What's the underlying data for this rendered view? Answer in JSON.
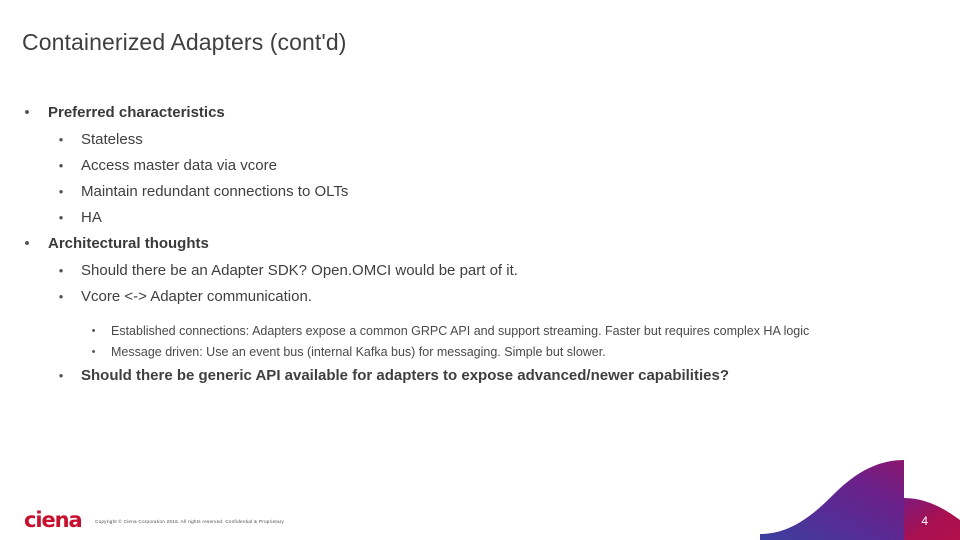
{
  "slide": {
    "title": "Containerized Adapters (cont'd)",
    "number": "4"
  },
  "content": [
    {
      "level": 1,
      "bold": true,
      "text": "Preferred characteristics"
    },
    {
      "level": 2,
      "bold": false,
      "text": "Stateless"
    },
    {
      "level": 2,
      "bold": false,
      "text": "Access master data via vcore"
    },
    {
      "level": 2,
      "bold": false,
      "text": "Maintain redundant connections to OLTs"
    },
    {
      "level": 2,
      "bold": false,
      "text": "HA"
    },
    {
      "level": 1,
      "bold": true,
      "text": "Architectural thoughts"
    },
    {
      "level": 2,
      "bold": false,
      "text": "Should there be an Adapter SDK?  Open.OMCI would be part of it."
    },
    {
      "level": 2,
      "bold": false,
      "text": "Vcore <-> Adapter communication."
    },
    {
      "level": 3,
      "bold": false,
      "text": "Established connections: Adapters expose a common GRPC API and support streaming.  Faster but requires complex HA logic"
    },
    {
      "level": 3,
      "bold": false,
      "text": "Message driven:  Use an event bus (internal Kafka bus) for messaging.   Simple but slower."
    },
    {
      "level": 2,
      "bold": true,
      "text": "Should there be generic API available for adapters to expose advanced/newer capabilities?"
    }
  ],
  "footer": {
    "logo_text": "ciena",
    "copyright": "Copyright © Ciena Corporation 2016.  All rights reserved.  Confidential & Proprietary"
  },
  "bullet_glyph": "•",
  "colors": {
    "brand_red": "#c8102e",
    "swoosh_blue": "#3b3f9e",
    "swoosh_purple": "#6b2088",
    "swoosh_crimson": "#a81050",
    "title_text": "#3f3f3f",
    "body_text": "#3f3f3f"
  }
}
